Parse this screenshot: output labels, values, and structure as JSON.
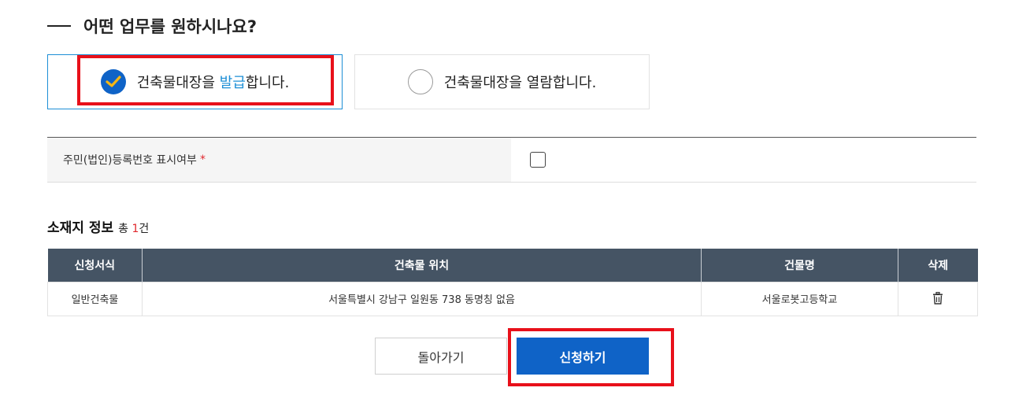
{
  "section": {
    "title": "어떤 업무를 원하시나요?"
  },
  "options": {
    "issue": {
      "prefix": "건축물대장을 ",
      "highlight": "발급",
      "suffix": "합니다.",
      "selected": true
    },
    "view": {
      "label": "건축물대장을 열람합니다.",
      "selected": false
    }
  },
  "form": {
    "resident_label": "주민(법인)등록번호 표시여부",
    "required_mark": "*",
    "checkbox_checked": false
  },
  "location": {
    "title": "소재지 정보",
    "count_prefix": "총 ",
    "count": "1",
    "count_suffix": "건",
    "columns": [
      "신청서식",
      "건축물 위치",
      "건물명",
      "삭제"
    ],
    "rows": [
      {
        "form_type": "일반건축물",
        "location": "서울특별시 강남구 일원동 738 동명칭 없음",
        "building_name": "서울로봇고등학교"
      }
    ]
  },
  "actions": {
    "back_label": "돌아가기",
    "apply_label": "신청하기"
  },
  "colors": {
    "accent": "#0f63c7",
    "highlight": "#1d8fd6",
    "header_bg": "#455464",
    "annotation": "#e8101a",
    "required": "#e0282e"
  },
  "icons": {
    "selected_radio": "check-circle-icon",
    "delete": "trash-icon"
  }
}
